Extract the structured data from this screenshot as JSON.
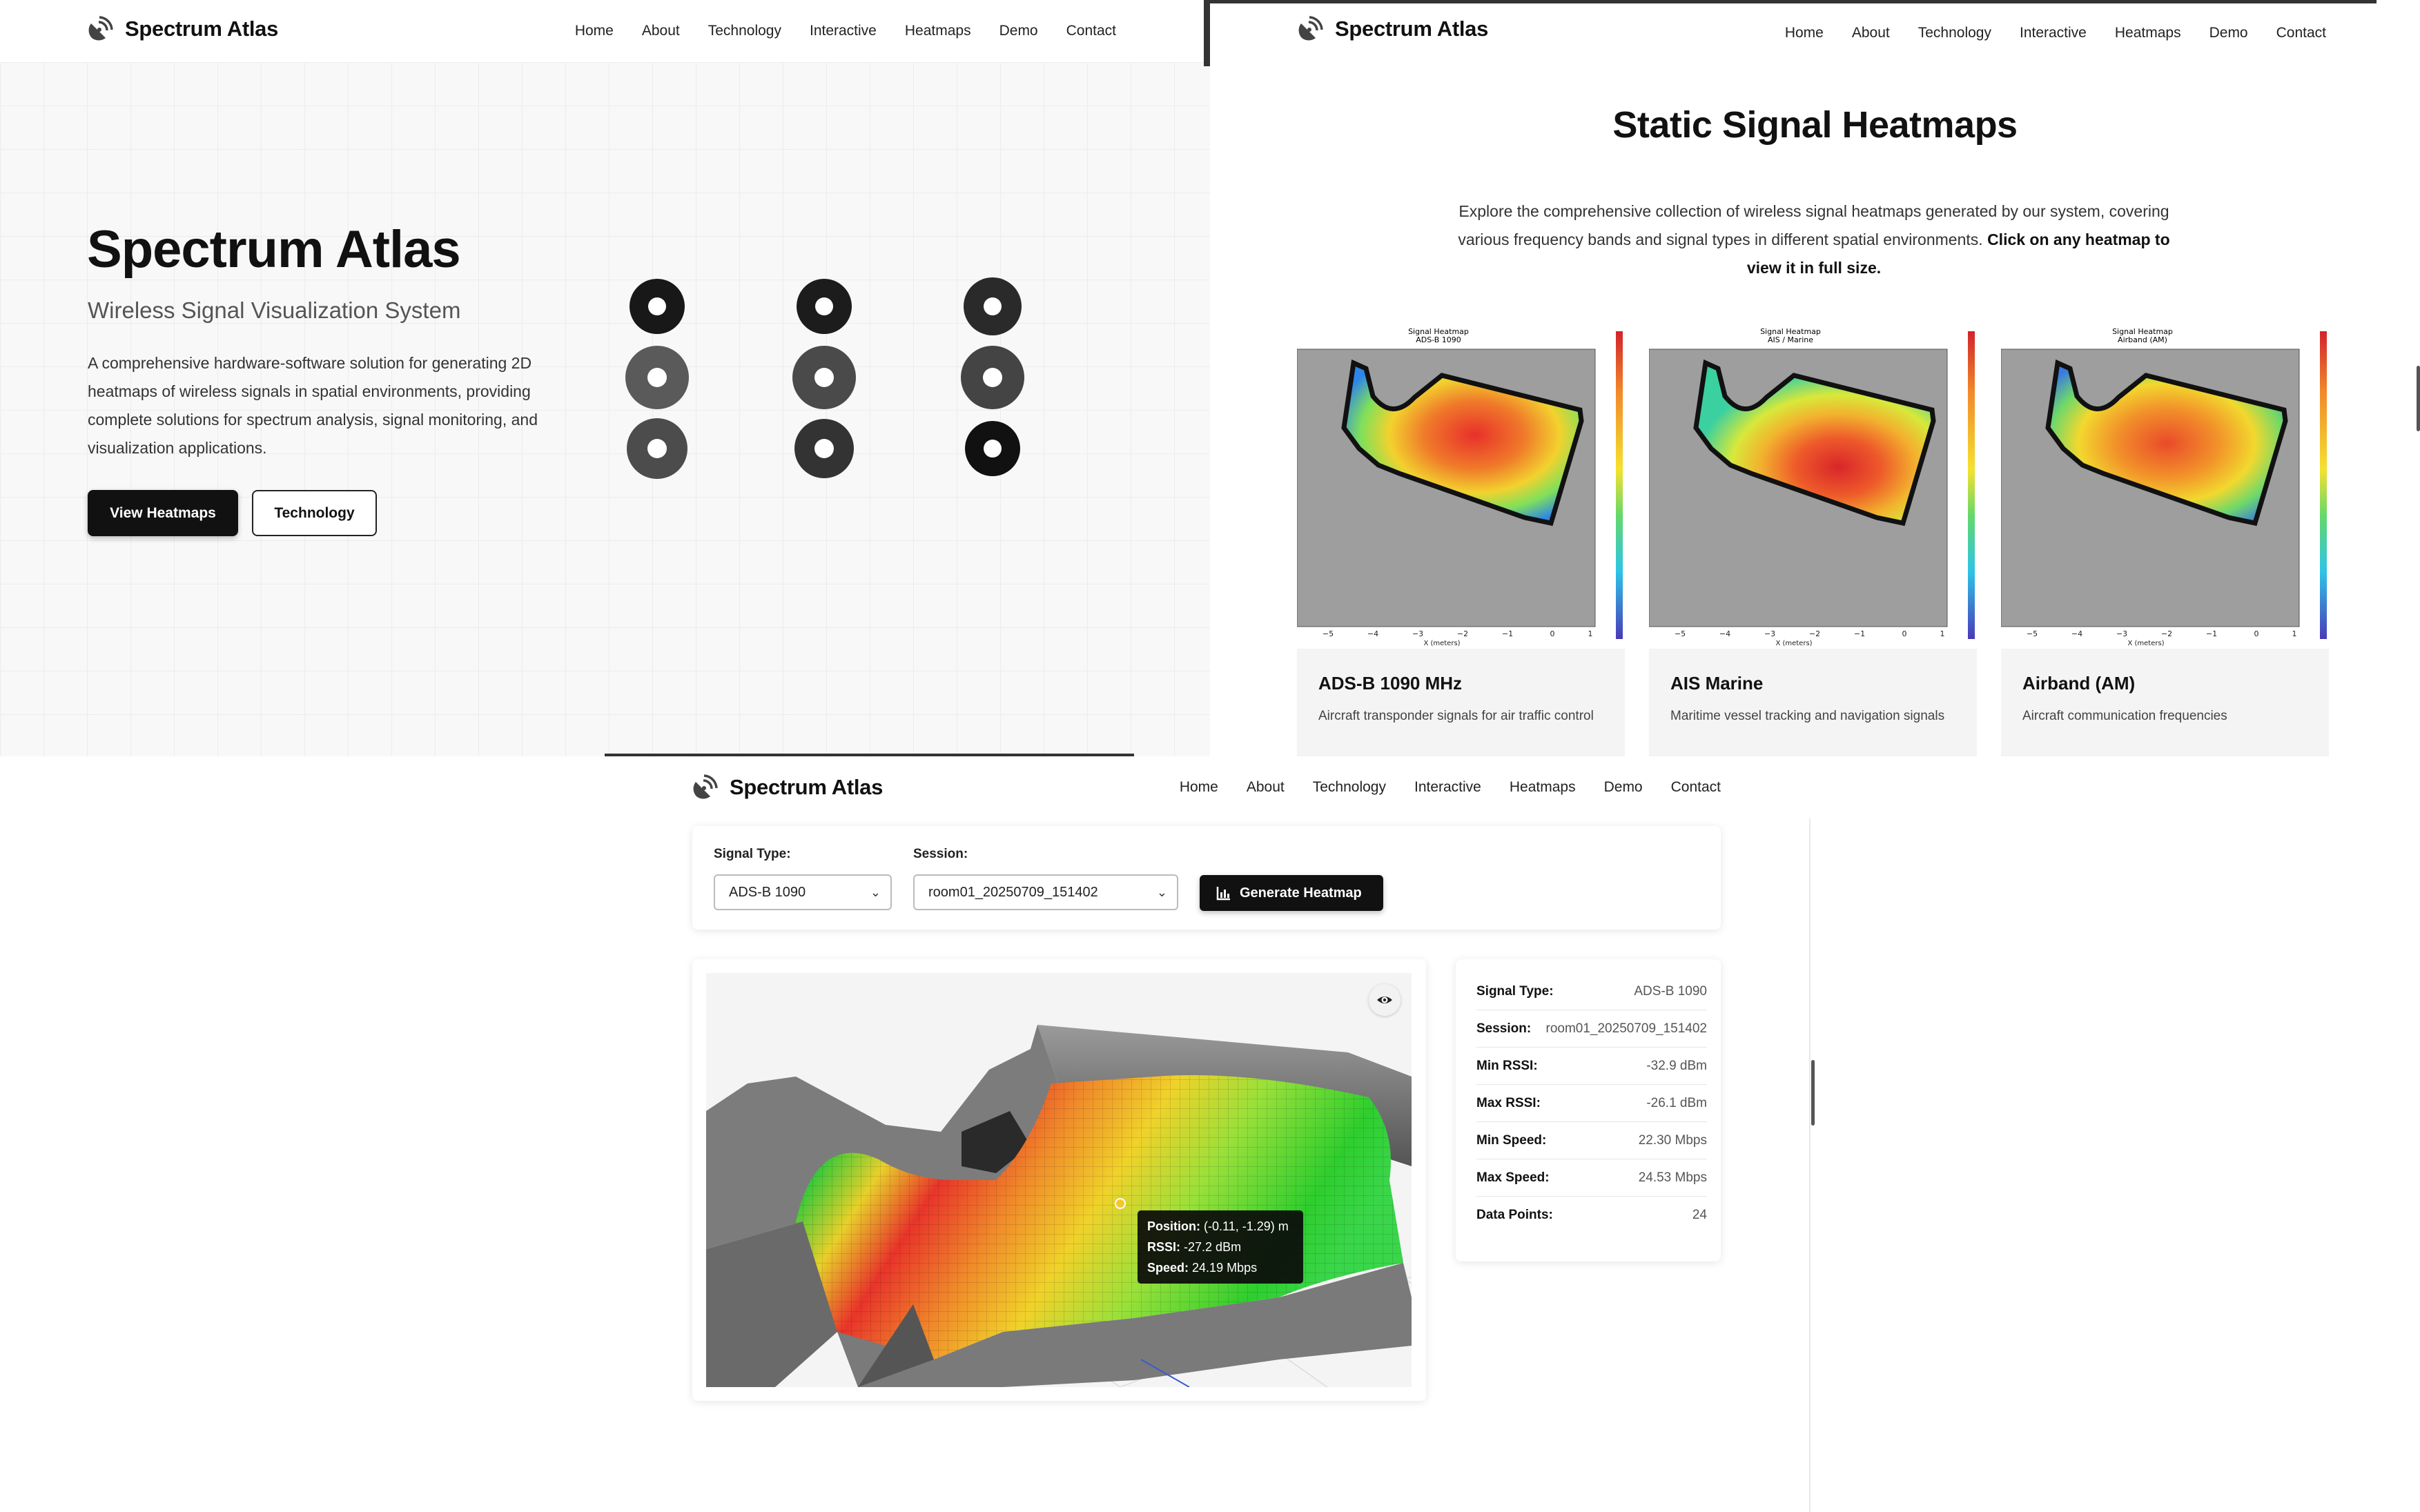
{
  "brand": {
    "name": "Spectrum Atlas",
    "logo_icon": "satellite-dish-icon"
  },
  "nav": {
    "items": [
      "Home",
      "About",
      "Technology",
      "Interactive",
      "Heatmaps",
      "Demo",
      "Contact"
    ]
  },
  "hero": {
    "title": "Spectrum Atlas",
    "subtitle": "Wireless Signal Visualization System",
    "description": "A comprehensive hardware-software solution for generating 2D heatmaps of wireless signals in spatial environments, providing complete solutions for spectrum analysis, signal monitoring, and visualization applications.",
    "primary_button": "View Heatmaps",
    "secondary_button": "Technology"
  },
  "heatmaps_section": {
    "title": "Static Signal Heatmaps",
    "description_plain": "Explore the comprehensive collection of wireless signal heatmaps generated by our system, covering various frequency bands and signal types in different spatial environments.",
    "description_bold": "Click on any heatmap to view it in full size.",
    "cards": [
      {
        "plot_title": "Signal Heatmap",
        "plot_subtitle": "ADS-B 1090",
        "title": "ADS-B 1090 MHz",
        "description": "Aircraft transponder signals for air traffic control"
      },
      {
        "plot_title": "Signal Heatmap",
        "plot_subtitle": "AIS / Marine",
        "title": "AIS Marine",
        "description": "Maritime vessel tracking and navigation signals"
      },
      {
        "plot_title": "Signal Heatmap",
        "plot_subtitle": "Airband (AM)",
        "title": "Airband (AM)",
        "description": "Aircraft communication frequencies"
      }
    ],
    "axis_label": "X (meters)",
    "axis_ticks": [
      "−5",
      "−4",
      "−3",
      "−2",
      "−1",
      "0",
      "1"
    ]
  },
  "interactive": {
    "signal_type_label": "Signal Type:",
    "signal_type_value": "ADS-B 1090",
    "session_label": "Session:",
    "session_value": "room01_20250709_151402",
    "generate_button": "Generate Heatmap",
    "tooltip": {
      "position_label": "Position:",
      "position_value": "(-0.11, -1.29) m",
      "rssi_label": "RSSI:",
      "rssi_value": "-27.2 dBm",
      "speed_label": "Speed:",
      "speed_value": "24.19 Mbps"
    },
    "stats": [
      {
        "key": "Signal Type:",
        "value": "ADS-B 1090"
      },
      {
        "key": "Session:",
        "value": "room01_20250709_151402"
      },
      {
        "key": "Min RSSI:",
        "value": "-32.9 dBm"
      },
      {
        "key": "Max RSSI:",
        "value": "-26.1 dBm"
      },
      {
        "key": "Min Speed:",
        "value": "22.30 Mbps"
      },
      {
        "key": "Max Speed:",
        "value": "24.53 Mbps"
      },
      {
        "key": "Data Points:",
        "value": "24"
      }
    ]
  }
}
